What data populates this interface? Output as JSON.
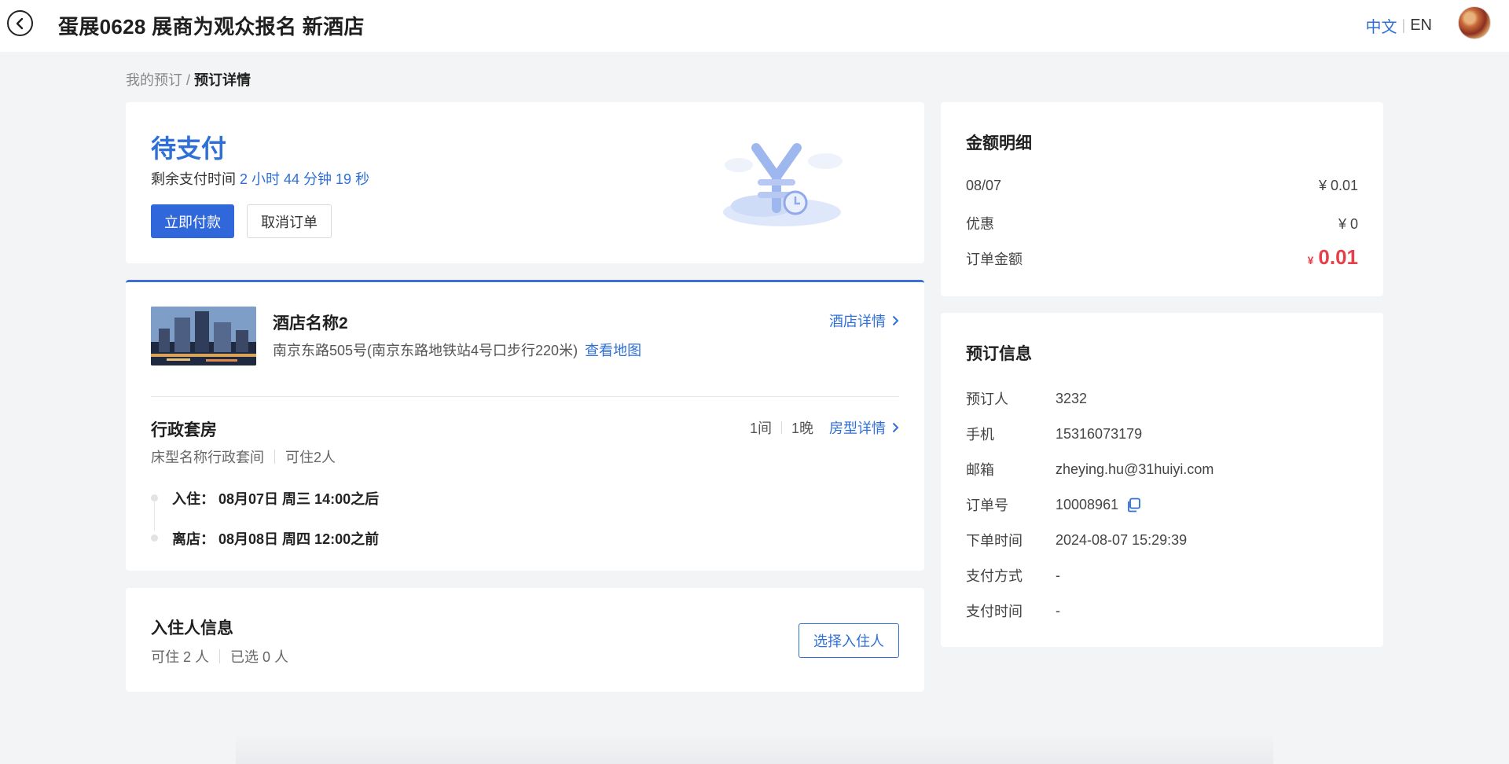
{
  "header": {
    "title": "蛋展0628 展商为观众报名 新酒店",
    "lang_zh": "中文",
    "lang_sep": "|",
    "lang_en": "EN"
  },
  "breadcrumb": {
    "parent": "我的预订",
    "sep": "/",
    "current": "预订详情"
  },
  "status": {
    "title": "待支付",
    "remain_label": "剩余支付时间",
    "remain_time": "2 小时 44 分钟 19 秒",
    "pay_button": "立即付款",
    "cancel_button": "取消订单"
  },
  "hotel": {
    "name": "酒店名称2",
    "address": "南京东路505号(南京东路地铁站4号口步行220米)",
    "map_link": "查看地图",
    "detail_link": "酒店详情",
    "room_name": "行政套房",
    "rooms": "1间",
    "nights": "1晚",
    "room_detail_link": "房型详情",
    "bed_type": "床型名称行政套间",
    "capacity": "可住2人",
    "checkin_label": "入住：",
    "checkin": "08月07日 周三 14:00之后",
    "checkout_label": "离店：",
    "checkout": "08月08日 周四 12:00之前"
  },
  "guests": {
    "title": "入住人信息",
    "capacity": "可住 2 人",
    "selected": "已选 0 人",
    "select_button": "选择入住人"
  },
  "amount": {
    "title": "金额明细",
    "rows": [
      {
        "label": "08/07",
        "value": "¥ 0.01"
      },
      {
        "label": "优惠",
        "value": "¥ 0"
      }
    ],
    "total_label": "订单金额",
    "total_currency": "¥",
    "total_value": "0.01"
  },
  "booking": {
    "title": "预订信息",
    "fields": [
      {
        "label": "预订人",
        "value": "3232"
      },
      {
        "label": "手机",
        "value": "15316073179"
      },
      {
        "label": "邮箱",
        "value": "zheying.hu@31huiyi.com"
      },
      {
        "label": "订单号",
        "value": "10008961"
      },
      {
        "label": "下单时间",
        "value": "2024-08-07 15:29:39"
      },
      {
        "label": "支付方式",
        "value": "-"
      },
      {
        "label": "支付时间",
        "value": "-"
      }
    ]
  },
  "colors": {
    "accent": "#2f6fd8",
    "primary_button": "#3067db",
    "price": "#e5404a",
    "background": "#f3f4f6"
  },
  "icons": [
    "back-arrow-icon",
    "chevron-right-icon",
    "copy-icon",
    "yuan-payment-illustration",
    "avatar"
  ]
}
